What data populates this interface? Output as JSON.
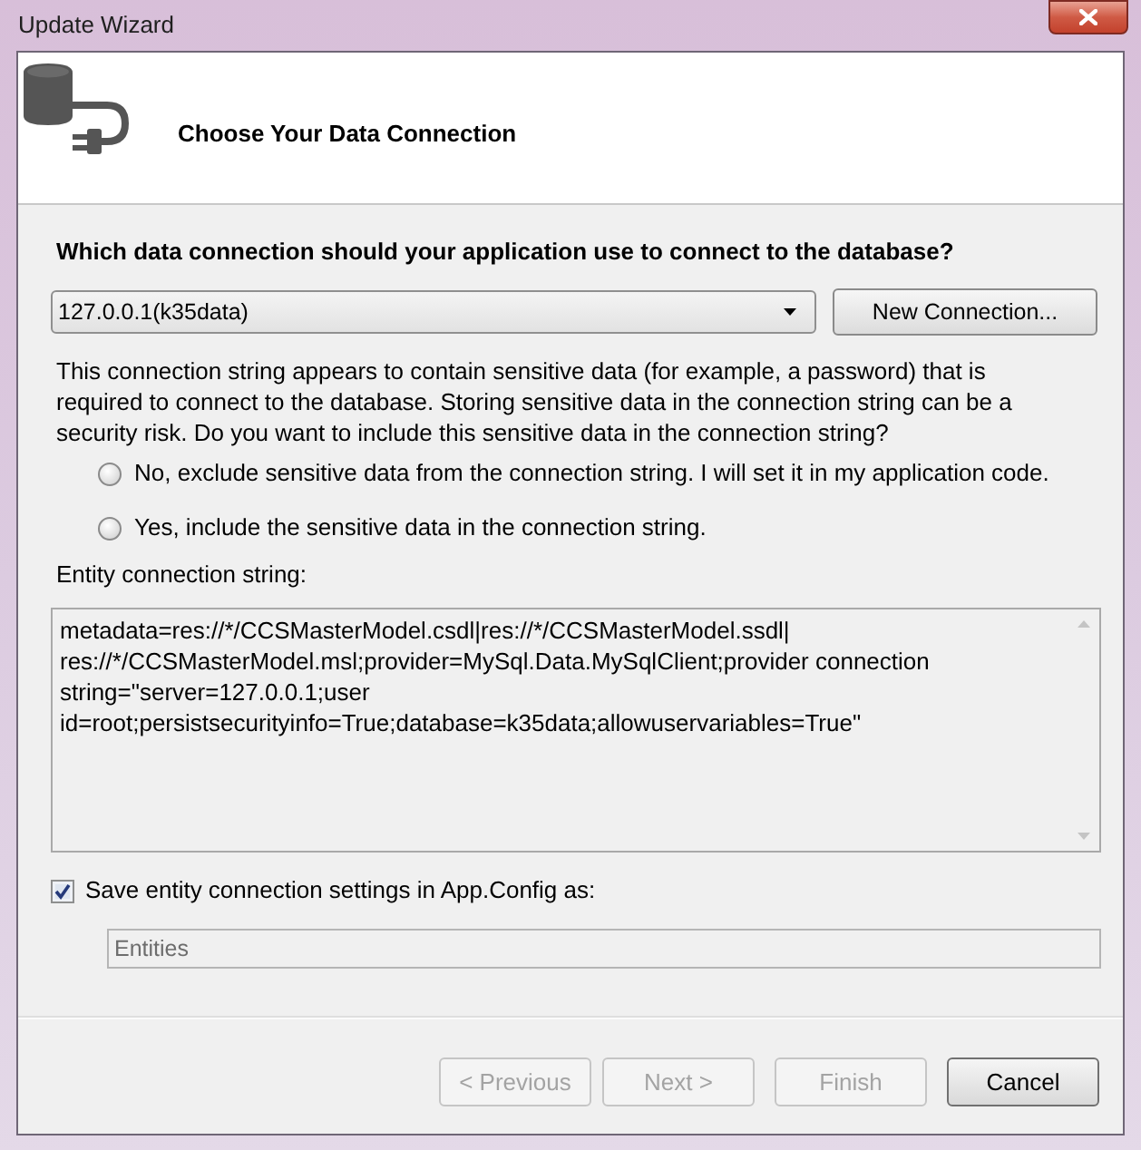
{
  "window": {
    "title": "Update Wizard"
  },
  "header": {
    "title": "Choose Your Data Connection"
  },
  "question": "Which data connection should your application use to connect to the database?",
  "connection_dropdown": {
    "value": "127.0.0.1(k35data)"
  },
  "new_connection_button": {
    "label": "New Connection..."
  },
  "warning": "This connection string appears to contain sensitive data (for example, a password) that is required to connect to the database. Storing sensitive data in the connection string can be a security risk. Do you want to include this sensitive data in the connection string?",
  "sensitive_options": [
    {
      "label": "No, exclude sensitive data from the connection string. I will set it in my application code.",
      "selected": false
    },
    {
      "label": "Yes, include the sensitive data in the connection string.",
      "selected": false
    }
  ],
  "entity_connection_string": {
    "label": "Entity connection string:",
    "lines": [
      "metadata=res://*/CCSMasterModel.csdl|res://*/CCSMasterModel.ssdl|",
      "res://*/CCSMasterModel.msl;provider=MySql.Data.MySqlClient;provider connection",
      "string=\"server=127.0.0.1;user",
      "id=root;persistsecurityinfo=True;database=k35data;allowuservariables=True\""
    ]
  },
  "save_settings": {
    "label": "Save entity connection settings in App.Config as:",
    "checked": true,
    "name_field": {
      "value": "Entities",
      "disabled": true
    }
  },
  "buttons": [
    {
      "label": "< Previous",
      "disabled": true
    },
    {
      "label": "Next >",
      "disabled": true
    },
    {
      "label": "Finish",
      "disabled": true
    },
    {
      "label": "Cancel",
      "disabled": false
    }
  ]
}
